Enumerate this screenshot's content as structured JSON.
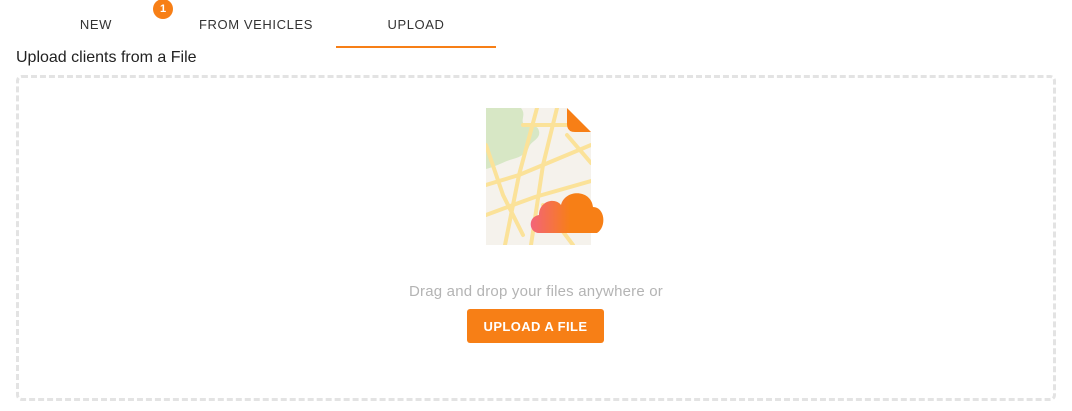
{
  "tabs": [
    {
      "label": "NEW",
      "active": false
    },
    {
      "label": "FROM VEHICLES",
      "active": false,
      "badge": "1"
    },
    {
      "label": "UPLOAD",
      "active": true
    }
  ],
  "upload": {
    "title": "Upload clients from a File",
    "hint": "Drag and drop your files anywhere or",
    "button_label": "UPLOAD A FILE",
    "illustration_icon": "map-file-cloud-upload-icon"
  },
  "colors": {
    "accent": "#f77f16",
    "hint_text": "#b4b4b4",
    "dashed_border": "#e3e3e3"
  }
}
